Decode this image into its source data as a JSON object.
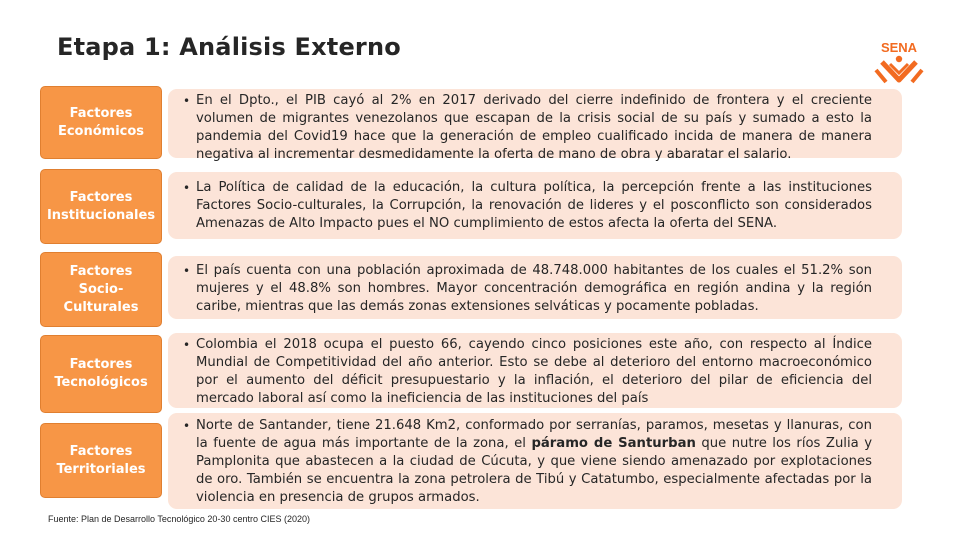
{
  "slide": {
    "title": "Etapa 1: Análisis Externo",
    "source": "Fuente: Plan de Desarrollo Tecnológico 20-30 centro CIES (2020)"
  },
  "logo": {
    "text": "SENA",
    "color": "#f26b21"
  },
  "colors": {
    "factor_bg": "#f79646",
    "desc_bg": "#fce4d8",
    "text": "#262626"
  },
  "factors": [
    {
      "label": "Factores Económicos",
      "text": "En el Dpto., el PIB cayó al 2% en 2017 derivado del cierre indefinido de frontera y el creciente volumen de migrantes venezolanos que escapan de la crisis social de su país y sumado a esto la pandemia del Covid19 hace que la generación de empleo cualificado incida de manera de manera negativa al incrementar desmedidamente la oferta de mano de obra y abaratar el salario."
    },
    {
      "label": "Factores Institucionales",
      "text": "La Política de calidad de la educación, la cultura política, la percepción frente a las instituciones Factores Socio-culturales, la Corrupción, la renovación de lideres y el posconflicto son considerados Amenazas de Alto Impacto pues el NO cumplimiento de estos afecta la oferta del SENA."
    },
    {
      "label": "Factores Socio-Culturales",
      "text": "El país cuenta con una población aproximada de 48.748.000 habitantes de los cuales el 51.2% son mujeres y el 48.8% son hombres. Mayor concentración demográfica en región andina y la región caribe, mientras que las demás zonas extensiones selváticas y pocamente pobladas."
    },
    {
      "label": "Factores Tecnológicos",
      "text": "Colombia el 2018 ocupa el puesto 66, cayendo cinco posiciones este año, con respecto al Índice Mundial de Competitividad del año anterior. Esto se debe al deterioro del entorno macroeconómico por el aumento del déficit presupuestario y la inflación, el deterioro del pilar de eficiencia del mercado laboral así como la ineficiencia de las instituciones del país"
    },
    {
      "label": "Factores Territoriales",
      "text_before": "Norte de Santander, tiene 21.648 Km2,  conformado por serranías, paramos, mesetas y llanuras, con la fuente de agua más importante de la zona, el ",
      "text_bold": "páramo de Santurban",
      "text_after": " que nutre los ríos Zulia y Pamplonita que abastecen a la ciudad de Cúcuta, y que viene siendo amenazado por explotaciones de oro. También se encuentra la zona petrolera de Tibú y Catatumbo, especialmente afectadas por la violencia en presencia de grupos armados."
    }
  ]
}
